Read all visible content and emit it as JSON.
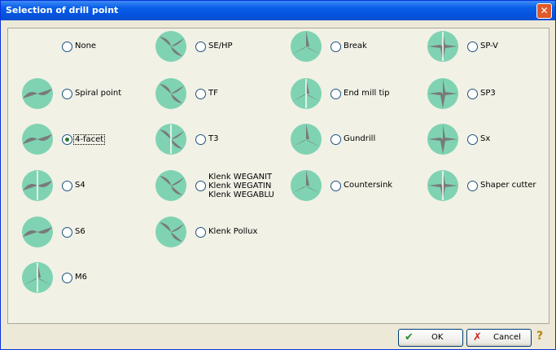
{
  "window": {
    "title": "Selection of drill point",
    "close_symbol": "✕"
  },
  "options": [
    {
      "label": "None",
      "thumb": "none",
      "selected": false
    },
    {
      "label": "SE/HP",
      "thumb": "se-hp-drill-icon",
      "selected": false
    },
    {
      "label": "Break",
      "thumb": "break-drill-icon",
      "selected": false
    },
    {
      "label": "SP-V",
      "thumb": "sp-v-drill-icon",
      "selected": false
    },
    {
      "label": "Spiral point",
      "thumb": "spiral-point-drill-icon",
      "selected": false
    },
    {
      "label": "TF",
      "thumb": "tf-drill-icon",
      "selected": false
    },
    {
      "label": "End mill tip",
      "thumb": "end-mill-tip-drill-icon",
      "selected": false
    },
    {
      "label": "SP3",
      "thumb": "sp3-drill-icon",
      "selected": false
    },
    {
      "label": "4-facet",
      "thumb": "four-facet-drill-icon",
      "selected": true
    },
    {
      "label": "T3",
      "thumb": "t3-drill-icon",
      "selected": false
    },
    {
      "label": "Gundrill",
      "thumb": "gundrill-drill-icon",
      "selected": false
    },
    {
      "label": "Sx",
      "thumb": "sx-drill-icon",
      "selected": false
    },
    {
      "label": "S4",
      "thumb": "s4-drill-icon",
      "selected": false
    },
    {
      "label": "Klenk WEGANIT\nKlenk WEGATIN\nKlenk WEGABLU",
      "thumb": "klenk-wega-drill-icon",
      "selected": false
    },
    {
      "label": "Countersink",
      "thumb": "countersink-drill-icon",
      "selected": false
    },
    {
      "label": "Shaper cutter",
      "thumb": "shaper-cutter-icon",
      "selected": false
    },
    {
      "label": "S6",
      "thumb": "s6-drill-icon",
      "selected": false
    },
    {
      "label": "Klenk Pollux",
      "thumb": "klenk-pollux-drill-icon",
      "selected": false
    },
    {
      "label": "M6",
      "thumb": "m6-drill-icon",
      "selected": false
    }
  ],
  "buttons": {
    "ok": "OK",
    "cancel": "Cancel",
    "help": "?"
  },
  "colors": {
    "accent": "#7fd3b2",
    "metal": "#7a7a7a",
    "title_blue": "#0a5fe8"
  }
}
